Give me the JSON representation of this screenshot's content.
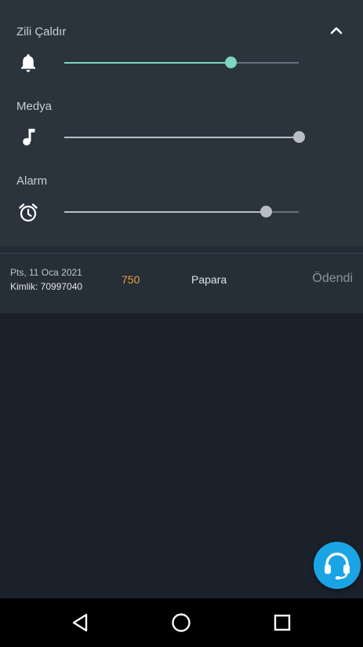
{
  "volume_panel": {
    "sliders": [
      {
        "label": "Zili Çaldır",
        "icon": "bell-icon",
        "level": 0.71,
        "color": "#7fd3c3"
      },
      {
        "label": "Medya",
        "icon": "music-note-icon",
        "level": 1.0,
        "color": "#b8bec4"
      },
      {
        "label": "Alarm",
        "icon": "alarm-clock-icon",
        "level": 0.86,
        "color": "#b8bec4"
      }
    ],
    "collapse_icon": "chevron-up-icon"
  },
  "transaction": {
    "date": "Pts, 11 Oca 2021",
    "id": "Kimlik: 70997040",
    "amount": "750",
    "method": "Papara",
    "status": "Ödendi"
  },
  "support_button": {
    "icon": "headset-icon",
    "color": "#1ba4e4"
  },
  "nav_bar": {
    "back": "back-triangle-icon",
    "home": "home-circle-icon",
    "recents": "recents-square-icon"
  }
}
